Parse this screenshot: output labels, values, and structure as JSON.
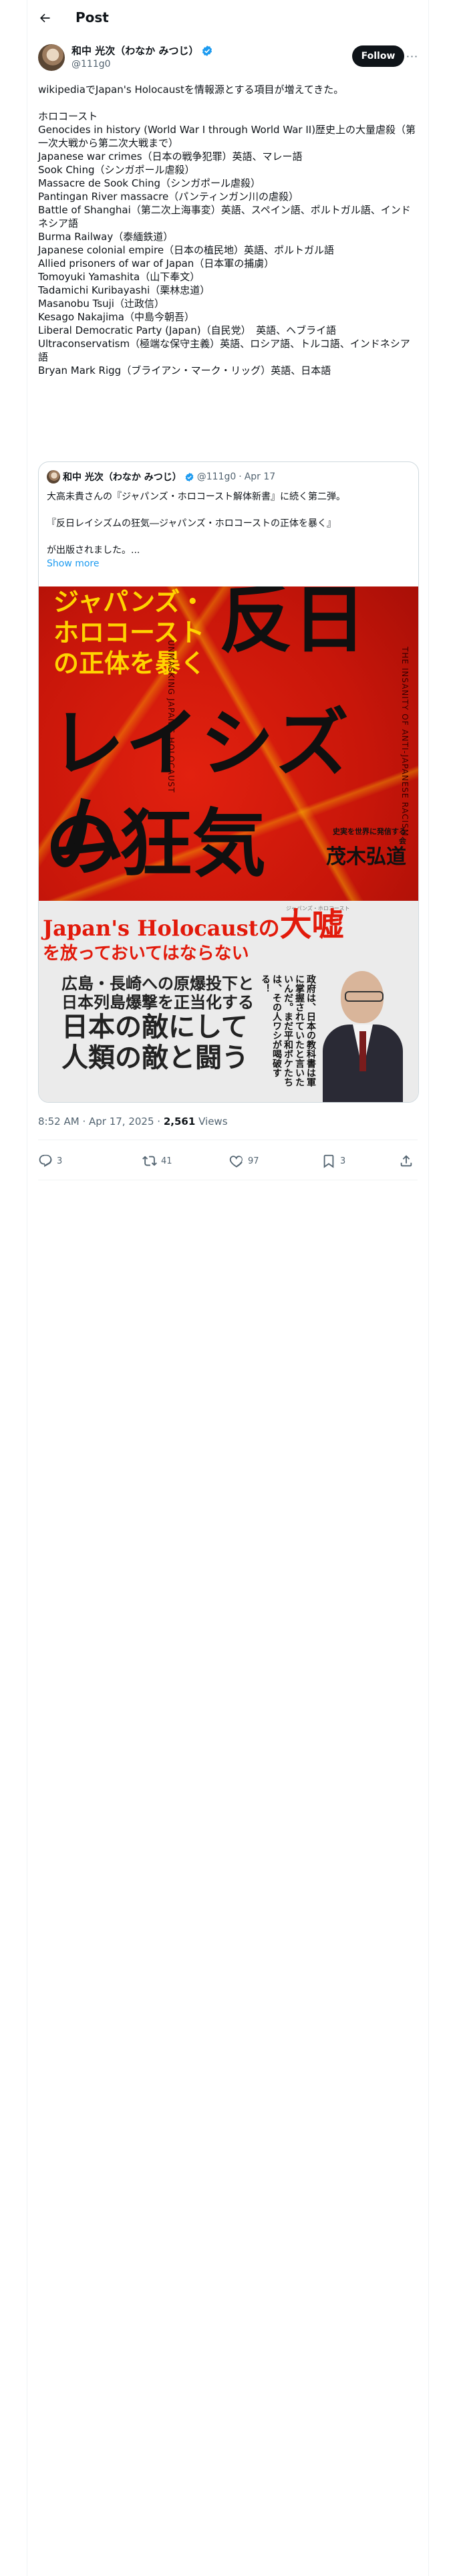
{
  "header": {
    "title": "Post"
  },
  "author": {
    "name": "和中 光次（わなか みつじ）",
    "handle": "@111g0",
    "follow_label": "Follow",
    "more_label": "···"
  },
  "tweet": {
    "lines": [
      "wikipediaでJapan's Holocaustを情報源とする項目が増えてきた。",
      "",
      "ホロコースト",
      "Genocides in history (World War I through World War II)歴史上の大量虐殺（第一次大戦から第二次大戦まで）",
      "Japanese war crimes（日本の戦争犯罪）英語、マレー語",
      "Sook Ching（シンガポール虐殺）",
      "Massacre de Sook Ching（シンガポール虐殺）",
      "Pantingan River massacre（パンティンガン川の虐殺）",
      "Battle of Shanghai（第二次上海事変）英語、スペイン語、ポルトガル語、インドネシア語",
      "Burma Railway（泰緬鉄道）",
      "Japanese colonial empire（日本の植民地）英語、ポルトガル語",
      "Allied prisoners of war of Japan（日本軍の捕虜）",
      "Tomoyuki Yamashita（山下奉文）",
      "Tadamichi Kuribayashi（栗林忠道）",
      "Masanobu Tsuji（辻政信）",
      "Kesago Nakajima（中島今朝吾）",
      "Liberal Democratic Party (Japan)（自民党）　英語、ヘブライ語",
      "Ultraconservatism（極端な保守主義）英語、ロシア語、トルコ語、インドネシア語",
      "Bryan Mark Rigg（ブライアン・マーク・リッグ）英語、日本語"
    ]
  },
  "quote": {
    "name": "和中 光次（わなか みつじ）",
    "handle": "@111g0",
    "date": "Apr 17",
    "lines": [
      "大高未貴さんの『ジャパンズ・ホロコースト解体新書』に続く第二弾。",
      "",
      "『反日レイシズムの狂気―ジャパンズ・ホロコーストの正体を暴く』",
      "",
      "が出版されました。..."
    ],
    "show_more": "Show more",
    "cover": {
      "yellow_title": "ジャパンズ・ホロコーストの正体を暴く",
      "main_title_1": "反日",
      "main_title_2": "レイシズム",
      "main_title_3": "の狂気",
      "side_text_1": "UNMASKING JAPAN'S HOLOCAUST",
      "side_text_2": "THE INSANITY OF ANTI-JAPANESE RACISM",
      "author_desc": "史実を世界に発信する会",
      "author_name": "茂木弘道",
      "ruby": "ジャパンズ・ホロコースト",
      "headline_1": "Japan's Holocaustの",
      "headline_big": "大嘘",
      "headline_2": "を放っておいてはならない",
      "obi_1": "広島・長崎への原爆投下と",
      "obi_2": "日本列島爆撃を正当化する",
      "obi_3": "日本の敵にして",
      "obi_4": "人類の敵と闘う",
      "obi_vertical": "政府は、日本の教科書は軍に掌握されていたと言いたいんだ。まだ平和ボケたちは、その人ワシが喝破する！"
    }
  },
  "meta": {
    "time": "8:52 AM",
    "date": "Apr 17, 2025",
    "separator": "·",
    "views_count": "2,561",
    "views_label": "Views"
  },
  "actions": {
    "replies": "3",
    "reposts": "41",
    "likes": "97",
    "bookmarks": "3"
  },
  "colors": {
    "accent": "#1d9bf0",
    "text": "#0f1419",
    "muted": "#536471",
    "border": "#cfd9de"
  }
}
